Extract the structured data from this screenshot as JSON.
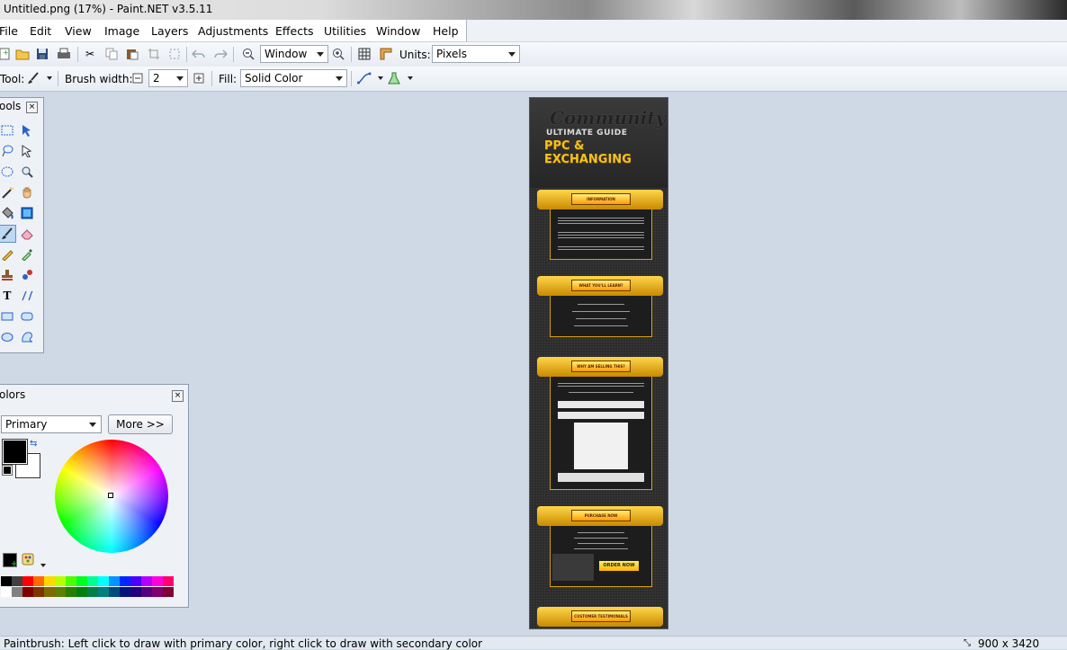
{
  "window": {
    "title": "Untitled.png (17%) - Paint.NET v3.5.11"
  },
  "menu": [
    "File",
    "Edit",
    "View",
    "Image",
    "Layers",
    "Adjustments",
    "Effects",
    "Utilities",
    "Window",
    "Help"
  ],
  "toolbar": {
    "zoom_value": "Window",
    "units_label": "Units:",
    "units_value": "Pixels",
    "tool_label": "Tool:",
    "brush_width_label": "Brush width:",
    "brush_width_value": "2",
    "fill_label": "Fill:",
    "fill_value": "Solid Color"
  },
  "tools_panel": {
    "title": "ools"
  },
  "colors_panel": {
    "title": "olors",
    "mode_value": "Primary",
    "more_label": "More >>",
    "primary_color": "#000000",
    "secondary_color": "#ffffff",
    "palette": [
      "#000000",
      "#404040",
      "#ff0000",
      "#ff6a00",
      "#ffd800",
      "#b6ff00",
      "#4cff00",
      "#00ff21",
      "#00ff90",
      "#00ffff",
      "#0094ff",
      "#0026ff",
      "#4800ff",
      "#b200ff",
      "#ff00dc",
      "#ff006e",
      "#ffffff",
      "#808080",
      "#7f0000",
      "#7f3300",
      "#7f6a00",
      "#5b7f00",
      "#267f00",
      "#007f0e",
      "#007f46",
      "#007f7f",
      "#004a7f",
      "#00137f",
      "#21007f",
      "#57007f",
      "#7f006e",
      "#7f0037"
    ]
  },
  "canvas_image": {
    "header_line1": "Community",
    "header_line2": "ULTIMATE GUIDE",
    "header_line3": "PPC & EXCHANGING",
    "sections": [
      "INFORMATION",
      "WHAT YOU'LL LEARN?",
      "WHY AM SELLING THIS?",
      "PURCHASE NOW",
      "CUSTOMER TESTIMONIALS"
    ],
    "order_button": "ORDER NOW"
  },
  "status": {
    "message": "Paintbrush: Left click to draw with primary color, right click to draw with secondary color",
    "image_size": "900 x 3420"
  }
}
